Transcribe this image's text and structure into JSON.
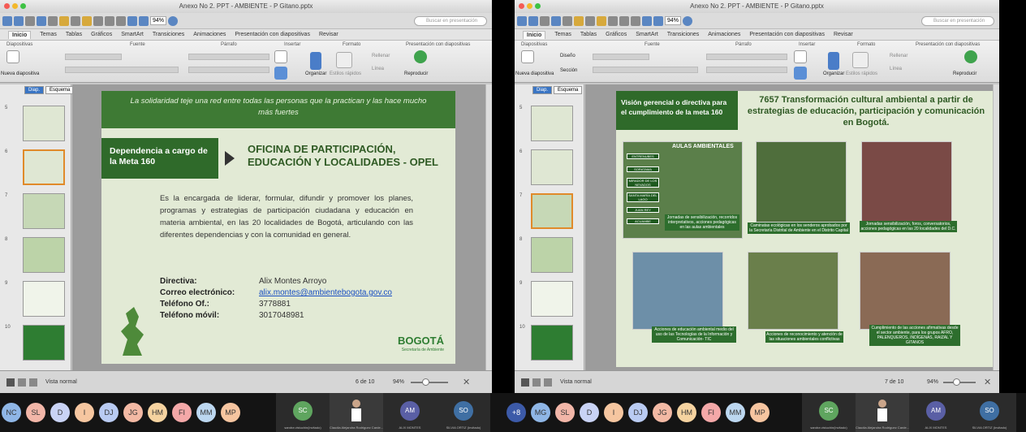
{
  "left": {
    "window_title": "Anexo No 2. PPT - AMBIENTE - P Gitano.pptx",
    "zoom": "94%",
    "search_placeholder": "Buscar en presentación",
    "tabs": [
      "Inicio",
      "Temas",
      "Tablas",
      "Gráficos",
      "SmartArt",
      "Transiciones",
      "Animaciones",
      "Presentación con diapositivas",
      "Revisar"
    ],
    "groups": {
      "diapositivas": "Diapositivas",
      "fuente": "Fuente",
      "parrafo": "Párrafo",
      "insertar": "Insertar",
      "formato": "Formato",
      "presentacion": "Presentación con diapositivas"
    },
    "buttons": {
      "nueva": "Nueva diapositiva",
      "organizar": "Organizar",
      "estilos": "Estilos rápidos",
      "rellenar": "Rellenar",
      "linea": "Línea",
      "reproducir": "Reproducir"
    },
    "sidebar_tabs": [
      "Diap.",
      "Esquema"
    ],
    "thumb_numbers": [
      "5",
      "6",
      "7",
      "8",
      "9",
      "10"
    ],
    "slide": {
      "quote": "La solidaridad teje una red entre todas las personas que la practican y las hace mucho más fuertes",
      "dep_label": "Dependencia a cargo de la Meta 160",
      "office": "OFICINA DE PARTICIPACIÓN, EDUCACIÓN Y LOCALIDADES - OPEL",
      "body": "Es la encargada de liderar, formular, difundir y promover los planes, programas y estrategias de participación ciudadana y educación en materia ambiental, en las 20  localidades de Bogotá, articulando con las diferentes dependencias y con la comunidad en general.",
      "contacts": [
        {
          "label": "Directiva:",
          "value": "Alix Montes Arroyo"
        },
        {
          "label": "Correo electrónico:",
          "value": "alix.montes@ambientebogota.gov.co"
        },
        {
          "label": "Teléfono Of.:",
          "value": "3778881"
        },
        {
          "label": "Teléfono móvil:",
          "value": "3017048981"
        }
      ],
      "logo": "BOGOTÁ",
      "logo_sub": "Secretaría de Ambiente"
    },
    "status": {
      "view": "Vista normal",
      "page": "6 de 10",
      "zoom": "94%"
    }
  },
  "right": {
    "window_title": "Anexo No 2. PPT - AMBIENTE - P Gitano.pptx",
    "zoom": "94%",
    "search_placeholder": "Buscar en presentación",
    "tabs": [
      "Inicio",
      "Temas",
      "Tablas",
      "Gráficos",
      "SmartArt",
      "Transiciones",
      "Animaciones",
      "Presentación con diapositivas",
      "Revisar"
    ],
    "groups": {
      "diapositivas": "Diapositivas",
      "fuente": "Fuente",
      "parrafo": "Párrafo",
      "insertar": "Insertar",
      "formato": "Formato",
      "presentacion": "Presentación con diapositivas"
    },
    "buttons": {
      "nueva": "Nueva diapositiva",
      "diseno": "Diseño",
      "seccion": "Sección",
      "organizar": "Organizar",
      "estilos": "Estilos rápidos",
      "rellenar": "Rellenar",
      "linea": "Línea",
      "reproducir": "Reproducir"
    },
    "sidebar_tabs": [
      "Diap.",
      "Esquema"
    ],
    "thumb_numbers": [
      "5",
      "6",
      "7",
      "8",
      "9",
      "10"
    ],
    "slide": {
      "vision": "Visión gerencial o directiva para el cumplimiento de la meta 160",
      "title": "7657 Transformación cultural ambiental a partir de estrategias de educación, participación y comunicación en Bogotá.",
      "aulas": "AULAS AMBIENTALES",
      "tags": [
        "ENTRENUBES",
        "SORATAMA",
        "MIRADOR DE LOS NEVADOS",
        "SANTA MARÍA DEL LAGO",
        "JUAN REY",
        "ACUAMBE"
      ],
      "captions": [
        "Jornadas de sensibilización, recorridos interpretativos, acciones pedagógicas en las aulas ambientales",
        "Caminatas ecológicas en los senderos aprobados por la Secretaría Distrital de Ambiente en el Distrito Capital",
        "Jornadas sensibilización, foros, conversatorios, acciones pedagógicas en las 20 localidades del D.C.",
        "Acciones de educación ambiental medio del uso de las Tecnologías de la Información y Comunicación- TIC",
        "Acciones de reconocimiento y atención de las situaciones ambientales conflictivas",
        "Cumplimiento de las acciones afirmativas desde el sector ambiente, para los grupos AFRO, PALENQUEROS, INDÍGENAS, RAIZAL Y GITANOS"
      ]
    },
    "status": {
      "view": "Vista normal",
      "page": "7 de 10",
      "zoom": "94%"
    }
  },
  "participants_left": [
    "NC",
    "SL",
    "D",
    "I",
    "DJ",
    "JG",
    "HM",
    "FI",
    "MM",
    "MP"
  ],
  "participants_right": [
    "+8",
    "MG",
    "SL",
    "D",
    "I",
    "DJ",
    "JG",
    "HM",
    "FI",
    "MM",
    "MP"
  ],
  "participant_colors": [
    "#8fb6e6",
    "#f2b6a8",
    "#c9d3f5",
    "#f6c6a0",
    "#b9cbf2",
    "#f3b9a4",
    "#f6d3a0",
    "#f4a8a8",
    "#bcd7f0",
    "#f6c5a0"
  ],
  "video_tiles_left": [
    {
      "initials": "SC",
      "name": "sandra vistuchin(invitado)",
      "color": "#5fa55f"
    },
    {
      "initials": "",
      "name": "Claudia Alejandra Rodriguez Carde...",
      "color": ""
    },
    {
      "initials": "AM",
      "name": "ALIX MONTES",
      "color": "#5a5fa5"
    },
    {
      "initials": "SO",
      "name": "SILVIA ORTIZ (Invitado)",
      "color": "#3f6fa3"
    }
  ],
  "video_tiles_right": [
    {
      "initials": "SC",
      "name": "sandra vistuchin(invitado)",
      "color": "#5fa55f"
    },
    {
      "initials": "",
      "name": "Claudia Alejandra Rodriguez Carde...",
      "color": ""
    },
    {
      "initials": "AM",
      "name": "ALIX MONTES",
      "color": "#5a5fa5"
    },
    {
      "initials": "SO",
      "name": "SILVIA ORTIZ (Invitado)",
      "color": "#3f6fa3"
    }
  ]
}
